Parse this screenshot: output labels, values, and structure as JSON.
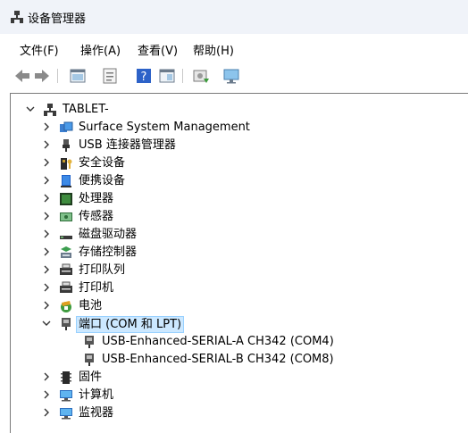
{
  "window": {
    "title": "设备管理器"
  },
  "menu": [
    "文件(F)",
    "操作(A)",
    "查看(V)",
    "帮助(H)"
  ],
  "toolbar_buttons": [
    "back-icon",
    "forward-icon",
    "properties-icon",
    "view-icon",
    "help-icon",
    "resource-view-icon",
    "update-driver-icon",
    "scan-hardware-icon"
  ],
  "tree": {
    "root": "TABLET-",
    "items": [
      {
        "label": "Surface System Management",
        "icon": "system-management-icon",
        "expanded": false
      },
      {
        "label": "USB 连接器管理器",
        "icon": "usb-connector-icon",
        "expanded": false
      },
      {
        "label": "安全设备",
        "icon": "security-device-icon",
        "expanded": false
      },
      {
        "label": "便携设备",
        "icon": "portable-device-icon",
        "expanded": false
      },
      {
        "label": "处理器",
        "icon": "processor-icon",
        "expanded": false
      },
      {
        "label": "传感器",
        "icon": "sensor-icon",
        "expanded": false
      },
      {
        "label": "磁盘驱动器",
        "icon": "disk-drive-icon",
        "expanded": false
      },
      {
        "label": "存储控制器",
        "icon": "storage-controller-icon",
        "expanded": false
      },
      {
        "label": "打印队列",
        "icon": "print-queue-icon",
        "expanded": false
      },
      {
        "label": "打印机",
        "icon": "printer-icon",
        "expanded": false
      },
      {
        "label": "电池",
        "icon": "battery-icon",
        "expanded": false
      },
      {
        "label": "端口 (COM 和 LPT)",
        "icon": "port-icon",
        "expanded": true,
        "selected": true,
        "children": [
          "USB-Enhanced-SERIAL-A CH342 (COM4)",
          "USB-Enhanced-SERIAL-B CH342 (COM8)"
        ]
      },
      {
        "label": "固件",
        "icon": "firmware-icon",
        "expanded": false
      },
      {
        "label": "计算机",
        "icon": "computer-icon",
        "expanded": false
      },
      {
        "label": "监视器",
        "icon": "monitor-icon",
        "expanded": false
      }
    ]
  }
}
